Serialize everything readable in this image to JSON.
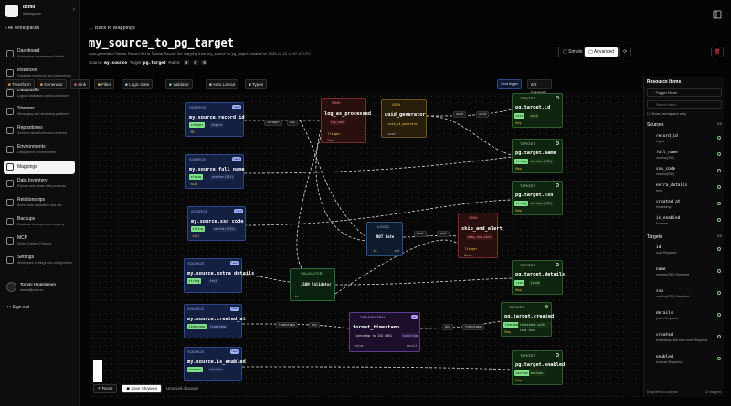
{
  "workspace": {
    "name": "demo",
    "sub": "Workspace"
  },
  "sidebar": {
    "all": "All Workspaces",
    "items": [
      {
        "label": "Dashboard",
        "sub": "Workspace overview and health"
      },
      {
        "label": "Instances",
        "sub": "Database instances and connections"
      },
      {
        "label": "Databases",
        "sub": "Logical databases across instances"
      },
      {
        "label": "Streams",
        "sub": "Messaging and streaming platforms"
      },
      {
        "label": "Repositories",
        "sub": "Schema repositories and versions"
      },
      {
        "label": "Environments",
        "sub": "Deployment environments"
      },
      {
        "label": "Mappings",
        "sub": ""
      },
      {
        "label": "Data Inventory",
        "sub": "Explore and create data products"
      },
      {
        "label": "Relationships",
        "sub": "Active data replication and cdc"
      },
      {
        "label": "Backups",
        "sub": "Database backups and recovery"
      },
      {
        "label": "MCP",
        "sub": "Model Context Protocol"
      },
      {
        "label": "Settings",
        "sub": "Workspace settings and configuration"
      }
    ],
    "user": {
      "name": "Tommi Hippelainen",
      "email": "tommi@redb.co"
    },
    "signout": "Sign out"
  },
  "header": {
    "back": "Back to Mappings",
    "title": "my_source_to_pg_target",
    "desc": "Auto-generated Tabular Record Set to Tabular Record Set mapping from 'my_source' to 'pg_target', created on 2025-12-10 14:07:10 UTC",
    "source_lbl": "Source:",
    "source": "my.source",
    "target_lbl": "Target:",
    "target": "pg.target",
    "rules_lbl": "Rules:",
    "rules": [
      "4",
      "0",
      "8"
    ],
    "simple": "Simple",
    "advanced": "Advanced"
  },
  "toolbar": {
    "items": [
      "Transform",
      "Generator",
      "Sink",
      "Filter",
      "Logic Gate",
      "Validator",
      "Auto Layout",
      "Types"
    ],
    "right": [
      "1 not trigger",
      "6/6 mapped"
    ]
  },
  "sources": [
    {
      "name": "my.source.record_id",
      "tags": [
        "integer",
        "bigint"
      ],
      "pk": "PK"
    },
    {
      "name": "my.source.full_name",
      "tags": [
        "string",
        "varchar(255)"
      ],
      "pk": "null"
    },
    {
      "name": "my.source.ssn_code",
      "tags": [
        "string",
        "varchar(255)"
      ],
      "pk": "null"
    },
    {
      "name": "my.source.extra_details",
      "tags": [
        "string",
        "text"
      ],
      "pk": ""
    },
    {
      "name": "my.source.created_at",
      "tags": [
        "timestamp",
        "timestamp"
      ],
      "pk": ""
    },
    {
      "name": "my.source.is_enabled",
      "tags": [
        "boolean",
        "boolean"
      ],
      "pk": ""
    }
  ],
  "source_hd": "SOURCE",
  "used": "Used",
  "target_hd": "TARGET",
  "targets": [
    {
      "name": "pg.target.id",
      "tags": [
        "uuid",
        "uuid"
      ],
      "k": "Key"
    },
    {
      "name": "pg.target.name",
      "tags": [
        "string",
        "varchar(255)"
      ],
      "k": "Req"
    },
    {
      "name": "pg.target.ssn",
      "tags": [
        "string",
        "varchar(255)"
      ],
      "k": "Req"
    },
    {
      "name": "pg.target.details",
      "tags": [
        "json",
        "jsonb"
      ],
      "k": "Req"
    },
    {
      "name": "pg.target.created",
      "tags": [
        "timestamp",
        "timestamp with time zone"
      ],
      "k": "Req"
    },
    {
      "name": "pg.target.enabled",
      "tags": [
        "boolean",
        "boolean"
      ],
      "k": "Req"
    }
  ],
  "nodes": {
    "sink1": {
      "hd": "SINK",
      "name": "log_as_processed",
      "tags": [
        "log_sink"
      ],
      "foot": [
        "Trigger",
        "Data"
      ]
    },
    "gen": {
      "hd": "GEN",
      "name": "uuid_generator",
      "tags": [
        "uuid_v4_generator"
      ],
      "foot": [
        "uuid"
      ]
    },
    "logic": {
      "hd": "LOGIC",
      "name": "NOT Gate",
      "foot": [
        "in",
        "out"
      ]
    },
    "sink2": {
      "hd": "SINK",
      "name": "skip_and_alert",
      "tags": [
        "skip_row_sink"
      ],
      "foot": [
        "Trigger",
        "Data"
      ]
    },
    "validator": {
      "hd": "VALIDATOR",
      "name": "JSON Validator",
      "foot": [
        "in",
        "out"
      ]
    },
    "transform": {
      "hd": "TRANSFORM",
      "name": "format_timestamp",
      "badge": "utc",
      "desc": "Timestamp to ISO 8601",
      "pill": "time/time",
      "foot": [
        "value",
        "result"
      ]
    }
  },
  "edges": [
    "integer",
    "any",
    "uuid",
    "uuid",
    "bool",
    "bool",
    "timestamp",
    "any",
    "any",
    "timestamp"
  ],
  "right_panel": {
    "title": "Resource Items",
    "mode": "Trigger Mode",
    "search": "Search item...",
    "unmapped": "Show unmapped only",
    "sources_lbl": "Sources",
    "sources_cnt": "6/6",
    "sources": [
      {
        "n": "record_id",
        "t": "bigint"
      },
      {
        "n": "full_name",
        "t": "varchar(255)"
      },
      {
        "n": "ssn_code",
        "t": "varchar(255)"
      },
      {
        "n": "extra_details",
        "t": "text"
      },
      {
        "n": "created_at",
        "t": "timestamp"
      },
      {
        "n": "is_enabled",
        "t": "boolean"
      }
    ],
    "targets_lbl": "Targets",
    "targets_cnt": "6/6",
    "targets": [
      {
        "n": "id",
        "t": "uuid Required"
      },
      {
        "n": "name",
        "t": "varchar(255) Required"
      },
      {
        "n": "ssn",
        "t": "varchar(255) Required"
      },
      {
        "n": "details",
        "t": "jsonb Required"
      },
      {
        "n": "created",
        "t": "timestamp with time zone Required"
      },
      {
        "n": "enabled",
        "t": "boolean Required"
      }
    ],
    "foot_l": "Drag items to canvas",
    "foot_r": "12 mapped"
  },
  "bottom": {
    "reset": "Reset",
    "save": "Save Changes",
    "unsaved": "Unsaved changes"
  },
  "colors": {
    "source": "#142042",
    "target": "#10250f",
    "sink": "#2a0f0f",
    "accent": "#ffffff"
  }
}
